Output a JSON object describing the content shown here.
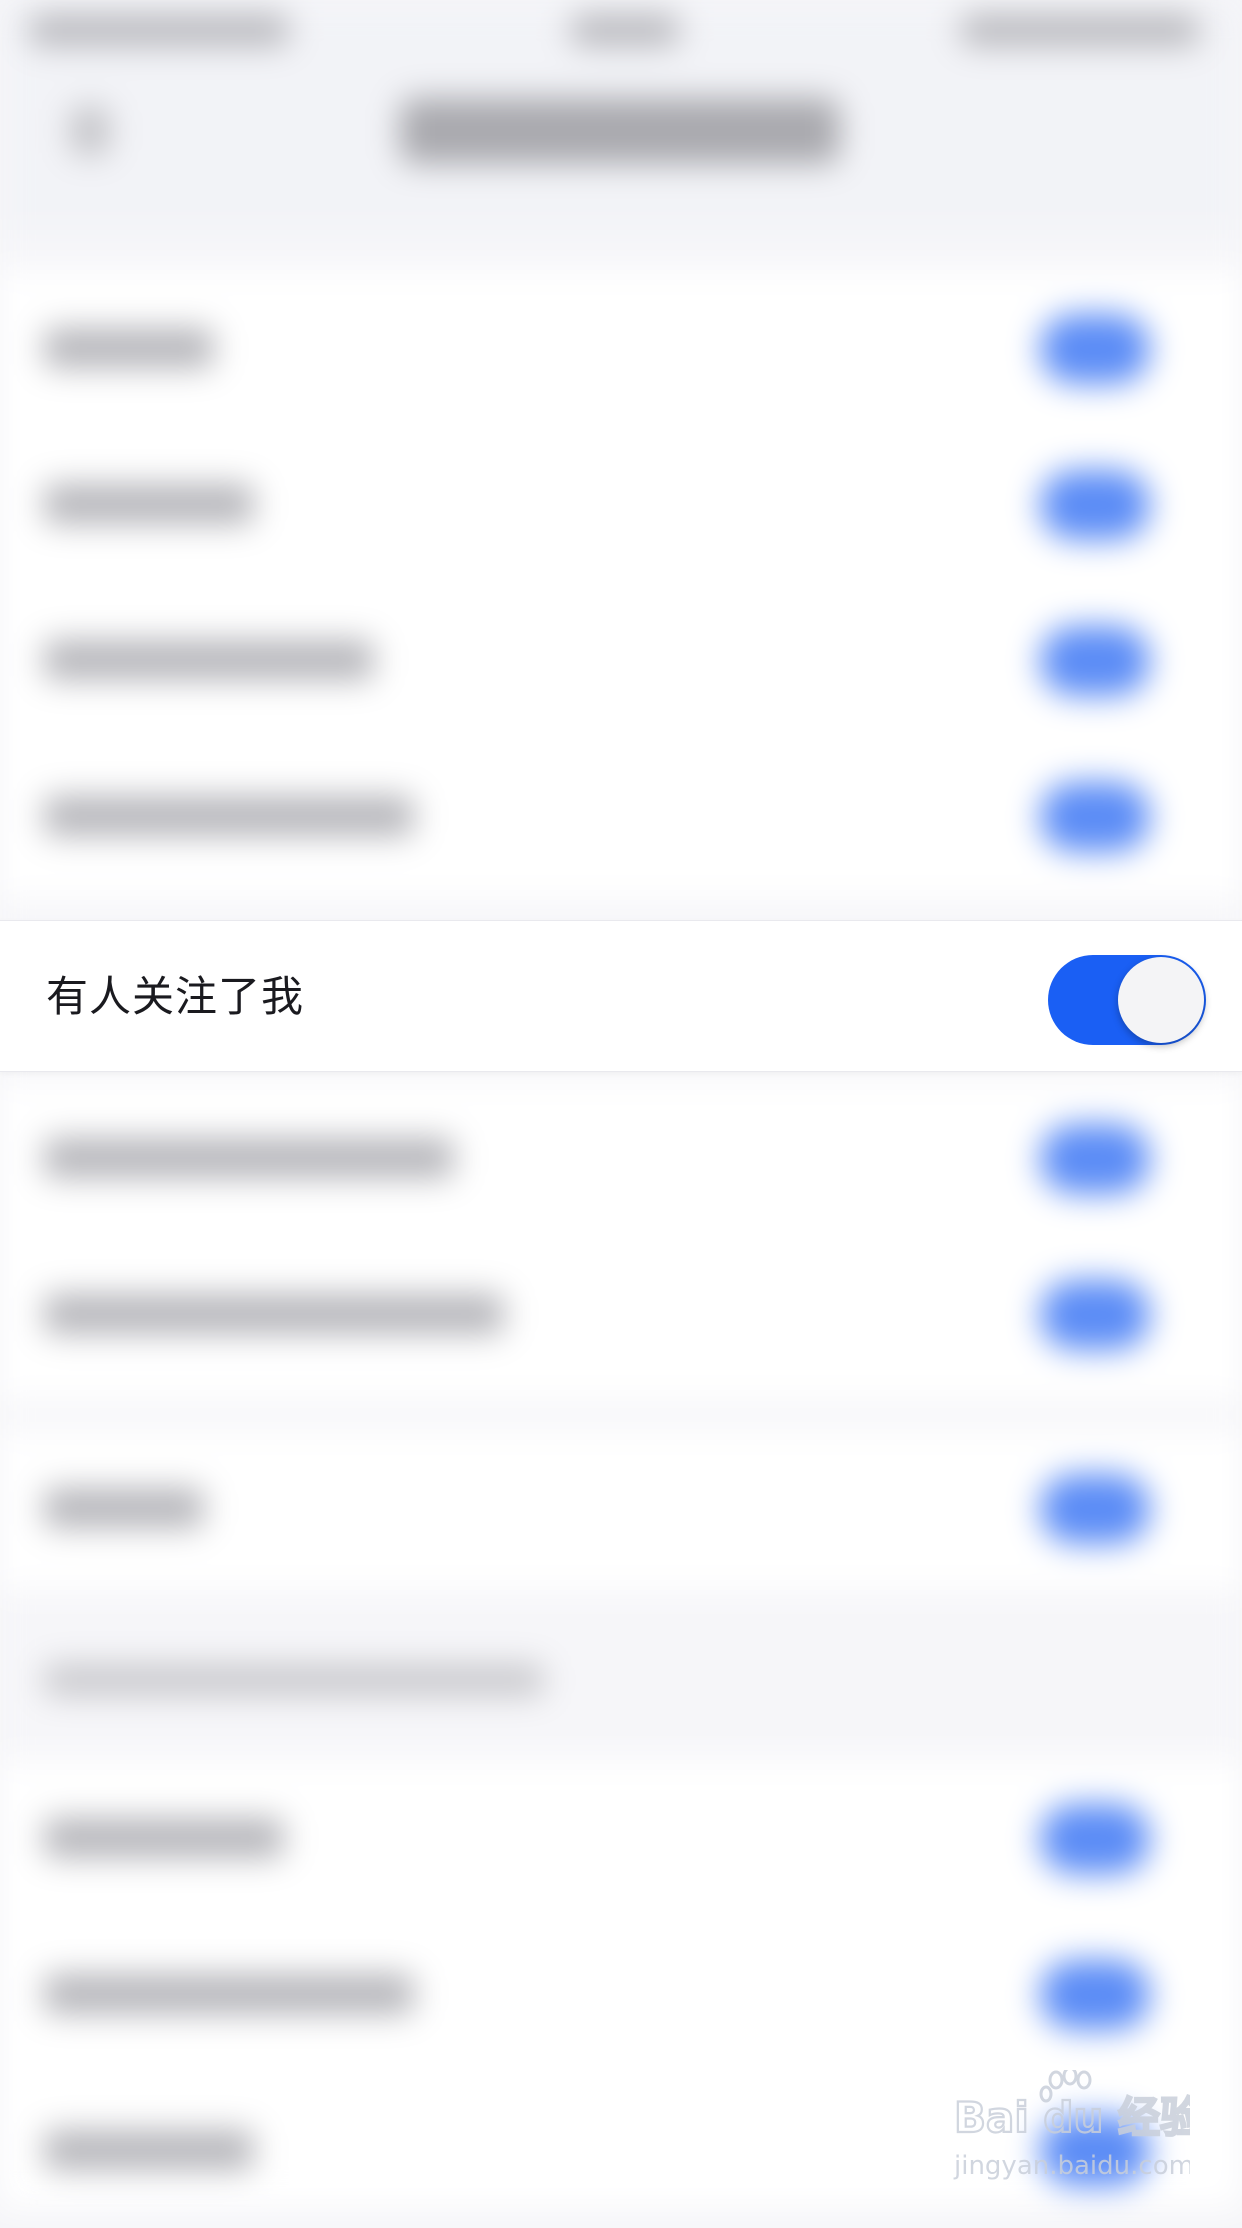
{
  "notification_settings": {
    "focused_item": {
      "label": "有人关注了我",
      "enabled": true
    }
  },
  "colors": {
    "accent": "#1a5ff4",
    "toggle_knob": "#f4f4f6",
    "background": "#f6f6f9",
    "row_background": "#ffffff",
    "label_text": "#1a1a1f"
  },
  "watermark": {
    "brand": "Bai du 经验",
    "url": "jingyan.baidu.com"
  }
}
